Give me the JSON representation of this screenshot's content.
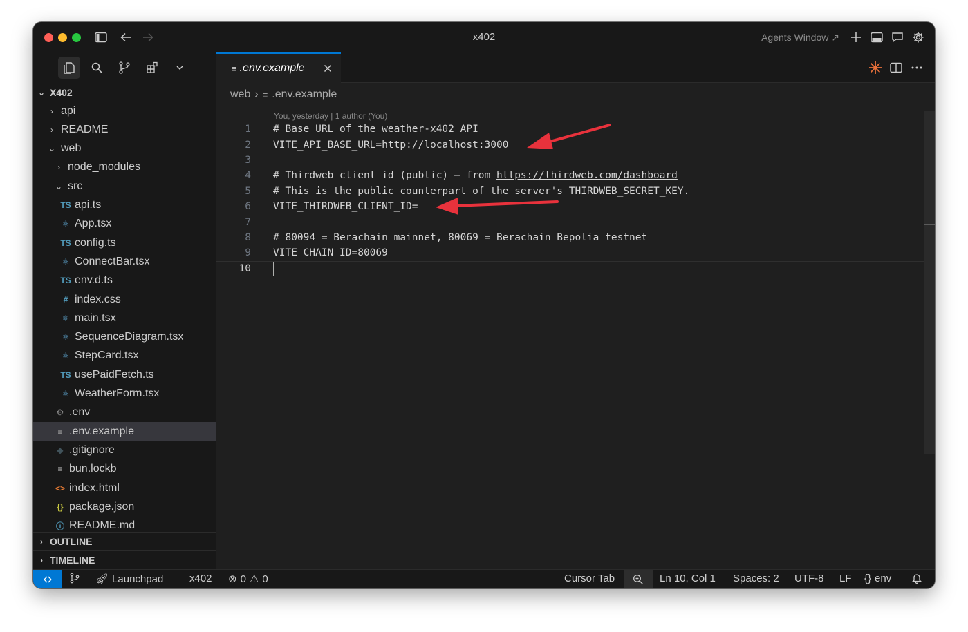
{
  "window": {
    "title": "x402",
    "agents_label": "Agents Window"
  },
  "explorer": {
    "root": "X402",
    "items": [
      {
        "label": "api",
        "type": "folder",
        "open": false,
        "depth": 0
      },
      {
        "label": "README",
        "type": "folder",
        "open": false,
        "depth": 0
      },
      {
        "label": "web",
        "type": "folder",
        "open": true,
        "depth": 0
      },
      {
        "label": "node_modules",
        "type": "folder",
        "open": false,
        "depth": 1
      },
      {
        "label": "src",
        "type": "folder",
        "open": true,
        "depth": 1
      },
      {
        "label": "api.ts",
        "type": "ts",
        "depth": 2
      },
      {
        "label": "App.tsx",
        "type": "react",
        "depth": 2
      },
      {
        "label": "config.ts",
        "type": "ts",
        "depth": 2
      },
      {
        "label": "ConnectBar.tsx",
        "type": "react",
        "depth": 2
      },
      {
        "label": "env.d.ts",
        "type": "ts",
        "depth": 2
      },
      {
        "label": "index.css",
        "type": "css",
        "depth": 2
      },
      {
        "label": "main.tsx",
        "type": "react",
        "depth": 2
      },
      {
        "label": "SequenceDiagram.tsx",
        "type": "react",
        "depth": 2
      },
      {
        "label": "StepCard.tsx",
        "type": "react",
        "depth": 2
      },
      {
        "label": "usePaidFetch.ts",
        "type": "ts",
        "depth": 2
      },
      {
        "label": "WeatherForm.tsx",
        "type": "react",
        "depth": 2
      },
      {
        "label": ".env",
        "type": "gear",
        "depth": 1
      },
      {
        "label": ".env.example",
        "type": "text",
        "depth": 1,
        "selected": true
      },
      {
        "label": ".gitignore",
        "type": "git",
        "depth": 1
      },
      {
        "label": "bun.lockb",
        "type": "text",
        "depth": 1
      },
      {
        "label": "index.html",
        "type": "html",
        "depth": 1
      },
      {
        "label": "package.json",
        "type": "json",
        "depth": 1
      },
      {
        "label": "README.md",
        "type": "info",
        "depth": 1
      }
    ],
    "outline_label": "OUTLINE",
    "timeline_label": "TIMELINE"
  },
  "tab": {
    "label": ".env.example"
  },
  "breadcrumb": {
    "folder": "web",
    "file": ".env.example"
  },
  "blame": "You, yesterday | 1 author (You)",
  "code_lines": [
    {
      "n": "1",
      "text": "# Base URL of the weather-x402 API"
    },
    {
      "n": "2",
      "prefix": "VITE_API_BASE_URL=",
      "link": "http://localhost:3000"
    },
    {
      "n": "3",
      "text": ""
    },
    {
      "n": "4",
      "prefix": "# Thirdweb client id (public) — from ",
      "link": "https://thirdweb.com/dashboard"
    },
    {
      "n": "5",
      "text": "# This is the public counterpart of the server's THIRDWEB_SECRET_KEY."
    },
    {
      "n": "6",
      "text": "VITE_THIRDWEB_CLIENT_ID="
    },
    {
      "n": "7",
      "text": ""
    },
    {
      "n": "8",
      "text": "# 80094 = Berachain mainnet, 80069 = Berachain Bepolia testnet"
    },
    {
      "n": "9",
      "text": "VITE_CHAIN_ID=80069"
    },
    {
      "n": "10",
      "text": "",
      "current": true
    }
  ],
  "status": {
    "launchpad": "Launchpad",
    "project": "x402",
    "errors": "0",
    "warnings": "0",
    "cursor_tab": "Cursor Tab",
    "position": "Ln 10, Col 1",
    "spaces": "Spaces: 2",
    "encoding": "UTF-8",
    "eol": "LF",
    "language": "env"
  },
  "colors": {
    "accent": "#0078d4",
    "annotation_arrow": "#e8323c"
  }
}
